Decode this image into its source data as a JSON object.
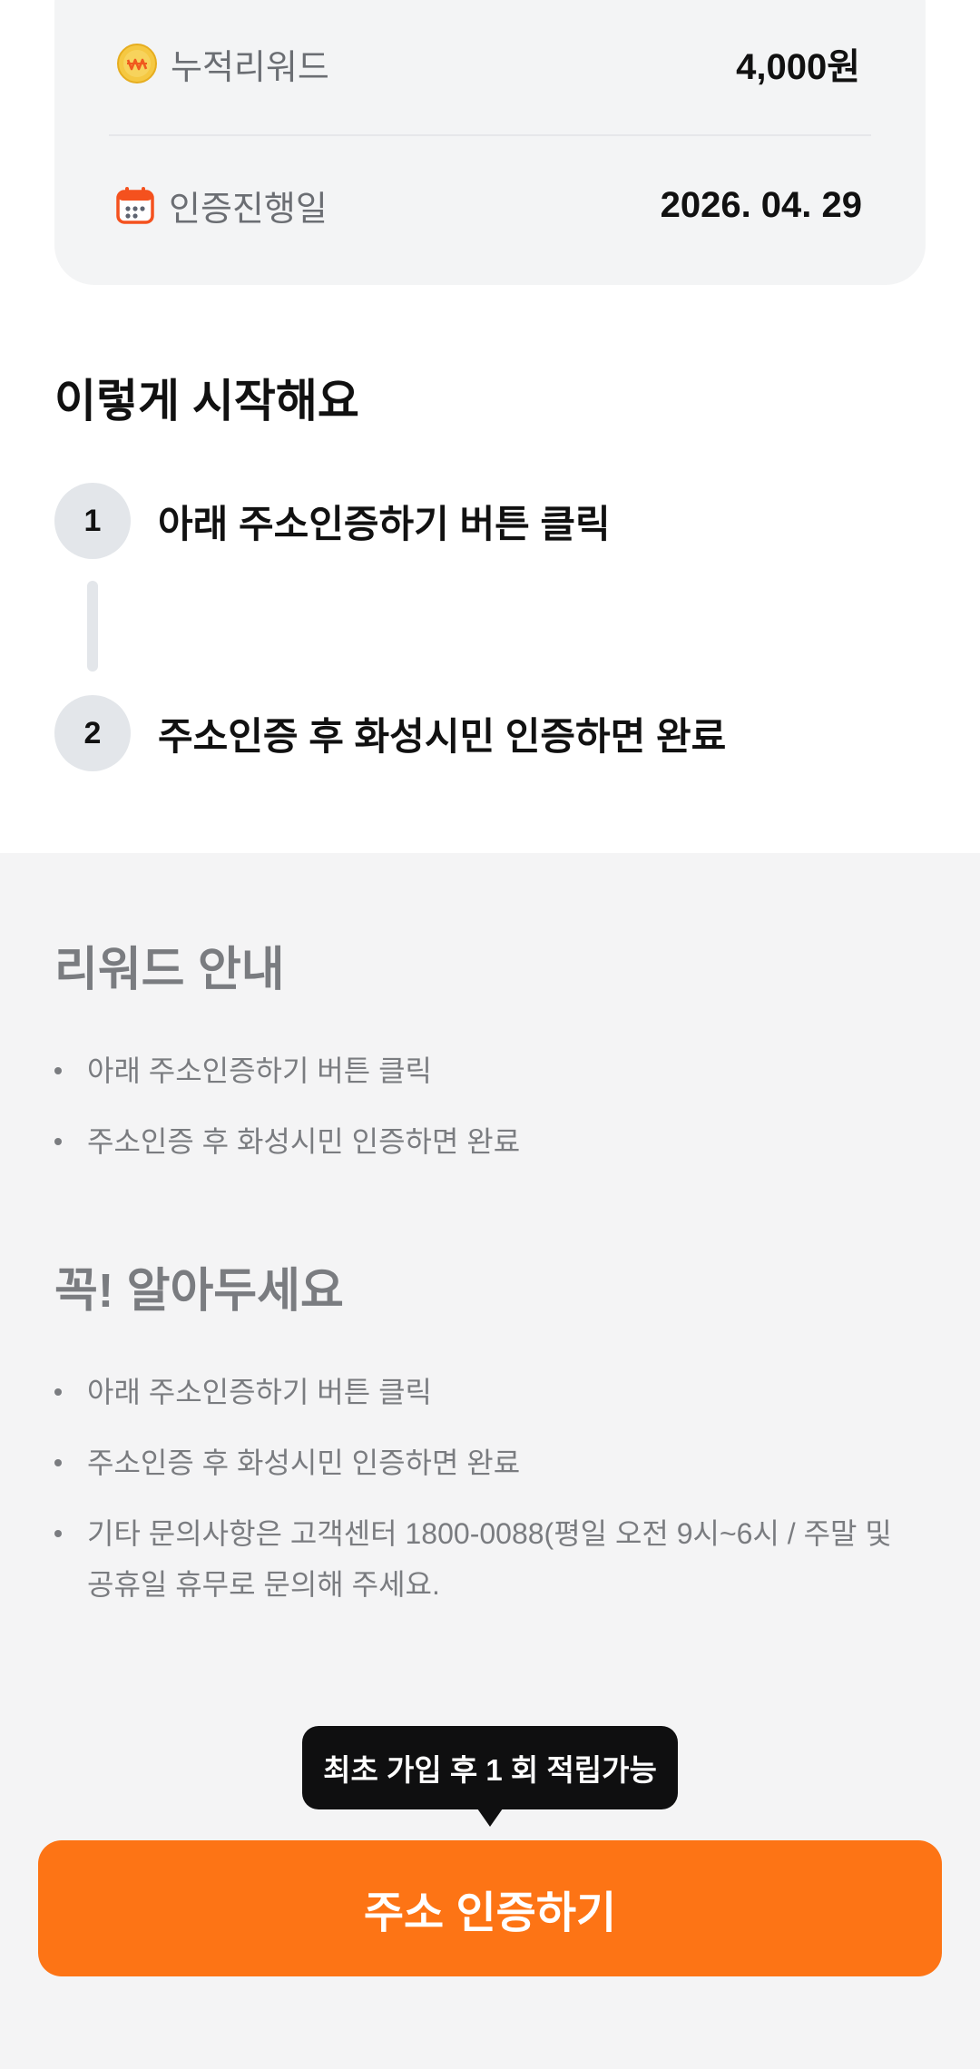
{
  "summary": {
    "reward": {
      "label": "누적리워드",
      "value": "4,000원",
      "icon": "won-coin-icon",
      "icon_color": "#f5c842"
    },
    "date": {
      "label": "인증진행일",
      "value": "2026. 04. 29",
      "icon": "calendar-icon",
      "icon_color": "#f4511e"
    }
  },
  "steps": {
    "title": "이렇게 시작해요",
    "items": [
      {
        "number": "1",
        "text": "아래 주소인증하기 버튼 클릭"
      },
      {
        "number": "2",
        "text": "주소인증 후 화성시민 인증하면 완료"
      }
    ]
  },
  "reward_guide": {
    "title": "리워드 안내",
    "items": [
      "아래 주소인증하기 버튼 클릭",
      "주소인증 후 화성시민 인증하면 완료"
    ]
  },
  "notice": {
    "title": "꼭! 알아두세요",
    "items": [
      "아래 주소인증하기 버튼 클릭",
      "주소인증 후 화성시민 인증하면 완료",
      "기타 문의사항은 고객센터 1800-0088(평일 오전 9시~6시 / 주말 및 공휴일 휴무로 문의해 주세요."
    ]
  },
  "tooltip": {
    "text": "최초 가입 후 1 회 적립가능"
  },
  "cta": {
    "label": "주소 인증하기",
    "color": "#fd7415"
  }
}
